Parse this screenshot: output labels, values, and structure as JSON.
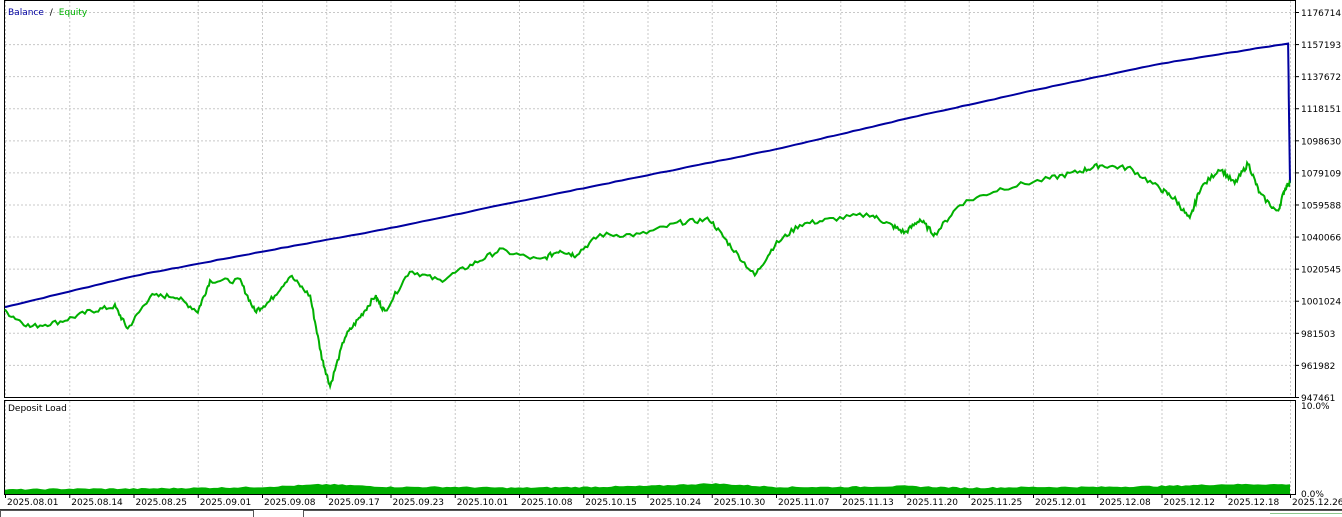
{
  "chart_data": [
    {
      "type": "line",
      "title": "Balance / Equity",
      "legend": [
        {
          "name": "Balance",
          "color": "#0000a0"
        },
        {
          "name": "Equity",
          "color": "#00b000"
        }
      ],
      "legend_separator": "/",
      "legend_placement": "top-left",
      "grid": true,
      "ylim": [
        947461,
        1176714
      ],
      "y_ticks": [
        "1176714",
        "1157193",
        "1137672",
        "1118151",
        "1098630",
        "1079109",
        "1059588",
        "1040066",
        "1020545",
        "1001024",
        "981503",
        "961982",
        "947461"
      ],
      "x_ticks": [
        "2025.08.01",
        "2025.08.14",
        "2025.08.25",
        "2025.09.01",
        "2025.09.08",
        "2025.09.17",
        "2025.09.23",
        "2025.10.01",
        "2025.10.08",
        "2025.10.15",
        "2025.10.24",
        "2025.10.30",
        "2025.11.07",
        "2025.11.13",
        "2025.11.20",
        "2025.11.25",
        "2025.12.01",
        "2025.12.08",
        "2025.12.12",
        "2025.12.18",
        "2025.12.26"
      ],
      "x_unit": "date tick index",
      "series": [
        {
          "name": "Balance",
          "color": "#0000a0",
          "x": [
            0,
            2,
            4,
            6,
            8,
            10,
            12,
            14,
            16,
            18,
            19.97,
            20.0
          ],
          "y": [
            1001024,
            1019500,
            1034000,
            1048000,
            1064000,
            1079500,
            1095000,
            1113000,
            1130000,
            1146000,
            1158000,
            1075000
          ]
        },
        {
          "name": "Equity",
          "color": "#00b000",
          "x": [
            0,
            0.39,
            0.86,
            1.32,
            1.71,
            1.91,
            2.26,
            2.65,
            3.0,
            3.19,
            3.66,
            3.89,
            4.12,
            4.44,
            4.75,
            4.93,
            5.06,
            5.29,
            5.53,
            5.76,
            5.91,
            6.3,
            6.77,
            7.24,
            7.7,
            8.33,
            8.64,
            8.87,
            9.26,
            9.88,
            10.51,
            10.97,
            11.28,
            11.67,
            11.98,
            12.37,
            12.84,
            13.46,
            13.77,
            14.01,
            14.24,
            14.47,
            14.86,
            15.49,
            16.26,
            16.73,
            17.04,
            17.51,
            17.98,
            18.21,
            18.44,
            18.6,
            18.91,
            19.14,
            19.35,
            19.53,
            19.81,
            19.92,
            20.0
          ],
          "y": [
            998423,
            989296,
            992338,
            998423,
            1001466,
            988079,
            1007551,
            1007551,
            998423,
            1016678,
            1016678,
            998423,
            1004508,
            1019721,
            1007551,
            971041,
            954003,
            983211,
            995381,
            1007551,
            998423,
            1022763,
            1016678,
            1025806,
            1034933,
            1028848,
            1034933,
            1031891,
            1044061,
            1044061,
            1051363,
            1053188,
            1037976,
            1019721,
            1037976,
            1050146,
            1053188,
            1056231,
            1050146,
            1045278,
            1053188,
            1044061,
            1062316,
            1071443,
            1077528,
            1081788,
            1085439,
            1083613,
            1071443,
            1065358,
            1053188,
            1071443,
            1083613,
            1074486,
            1086656,
            1068401,
            1057448,
            1071443,
            1075703
          ]
        }
      ]
    },
    {
      "type": "area",
      "title": "Deposit Load",
      "color": "#00b000",
      "ylim": [
        0,
        10
      ],
      "y_ticks": [
        "10.0%",
        "0.0%"
      ],
      "x": [
        0,
        1,
        2,
        3,
        4,
        5,
        6,
        7,
        8,
        9,
        10,
        11,
        12,
        13,
        14,
        15,
        16,
        17,
        18,
        19,
        20
      ],
      "y": [
        0.5,
        0.6,
        0.6,
        0.7,
        0.8,
        1.1,
        0.8,
        0.8,
        0.7,
        0.8,
        0.9,
        1.2,
        0.8,
        0.8,
        0.9,
        0.7,
        0.8,
        0.8,
        0.9,
        1.1,
        1.1
      ]
    }
  ]
}
